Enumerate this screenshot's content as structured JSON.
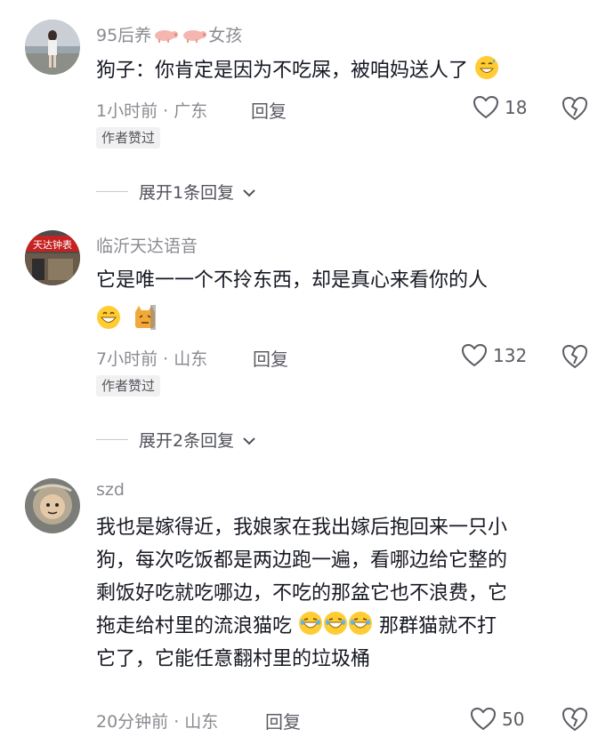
{
  "comments": [
    {
      "username_part1": "95后养",
      "username_part2": "女孩",
      "text": "狗子：你肯定是因为不吃屎，被咱妈送人了",
      "time_location": "1小时前 · 广东",
      "reply_label": "回复",
      "likes": "18",
      "badge": "作者赞过",
      "expand": "展开1条回复"
    },
    {
      "username": "临沂天达语音",
      "avatar_sign_text": "天达钟表",
      "text": "它是唯一一个不拎东西，却是真心来看你的人",
      "time_location": "7小时前 · 山东",
      "reply_label": "回复",
      "likes": "132",
      "badge": "作者赞过",
      "expand": "展开2条回复"
    },
    {
      "username": "szd",
      "text_line1": "我也是嫁得近，我娘家在我出嫁后抱回来一只小",
      "text_line2": "狗，每次吃饭都是两边跑一遍，看哪边给它整的",
      "text_line3": "剩饭好吃就吃哪边，不吃的那盆它也不浪费，它",
      "text_line4a": "拖走给村里的流浪猫吃",
      "text_line4b": "那群猫就不打",
      "text_line5": "它了，它能任意翻村里的垃圾桶",
      "time_location": "20分钟前 · 山东",
      "reply_label": "回复",
      "likes": "50"
    }
  ],
  "icons": {
    "like": "heart-outline-icon",
    "dislike": "broken-heart-icon",
    "expand": "chevron-down-icon",
    "emoji_sweat": "grinning-sweat-emoji",
    "emoji_grin": "grinning-emoji",
    "emoji_cat": "cat-emoji",
    "emoji_laugh": "rolling-laughing-emoji",
    "pig": "pig-emoji"
  },
  "colors": {
    "meta": "#8a8b91",
    "text": "#161823",
    "badge_bg": "#f1f1f2"
  }
}
